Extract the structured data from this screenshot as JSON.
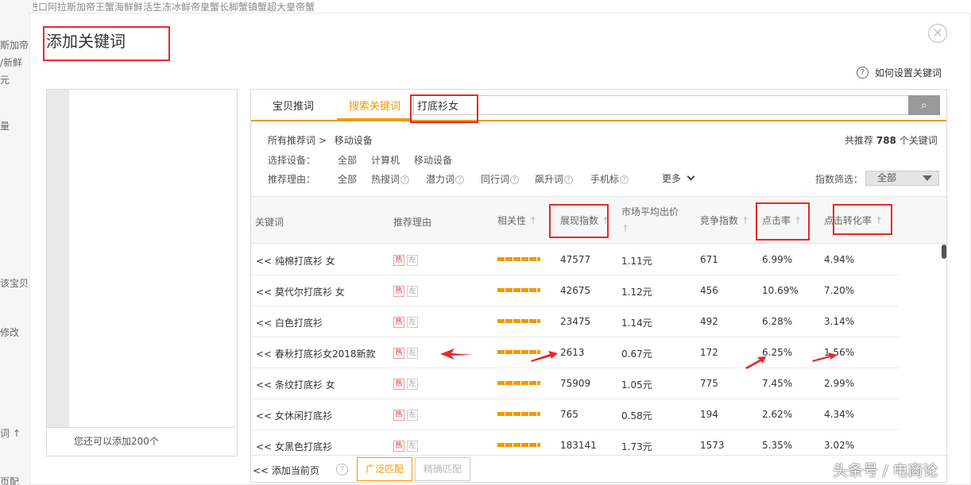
{
  "background": {
    "top_text": "宝贝：进口阿拉斯加帝王蟹海鲜鲜活生冻冰鲜帝皇蟹长脚蟹镇蟹超大皇帝蟹",
    "left_fragments": [
      "斯加帝",
      "/新鲜",
      "元",
      "量",
      "",
      "该宝贝",
      "修改",
      "",
      "词 ↑",
      "页配"
    ]
  },
  "dialog": {
    "title": "添加关键词",
    "close_glyph": "×",
    "help_text": "如何设置关键词",
    "help_glyph": "?"
  },
  "left_panel": {
    "footer": "您还可以添加200个"
  },
  "tabs": [
    {
      "label": "宝贝推词"
    },
    {
      "label": "搜索关键词"
    }
  ],
  "search": {
    "value": "打底衫女",
    "button_glyph": "⌕"
  },
  "breadcrumb": {
    "root": "所有推荐词",
    "separator": ">",
    "current": "移动设备"
  },
  "total": {
    "prefix": "共推荐",
    "count": "788",
    "suffix": "个关键词"
  },
  "device_filter": {
    "label": "选择设备：",
    "options": [
      "全部",
      "计算机",
      "移动设备"
    ]
  },
  "reason_filter": {
    "label": "推荐理由：",
    "options": [
      "全部",
      "热搜词",
      "潜力词",
      "同行词",
      "飙升词",
      "手机标"
    ],
    "more": "更多"
  },
  "index_filter": {
    "label": "指数筛选：",
    "value": "全部"
  },
  "table": {
    "headers": {
      "keyword": "关键词",
      "reason": "推荐理由",
      "relevance": "相关性",
      "impressions": "展现指数",
      "avg_bid": "市场平均出价",
      "competition": "竞争指数",
      "ctr": "点击率",
      "cvr": "点击转化率"
    },
    "sort_glyph": "↑",
    "add_glyph": "<<",
    "tag_hot": "热",
    "tag_left": "左",
    "rows": [
      {
        "keyword": "纯棉打底衫 女",
        "impressions": "47577",
        "avg_bid": "1.11元",
        "competition": "671",
        "ctr": "6.99%",
        "cvr": "4.94%"
      },
      {
        "keyword": "莫代尔打底衫 女",
        "impressions": "42675",
        "avg_bid": "1.12元",
        "competition": "456",
        "ctr": "10.69%",
        "cvr": "7.20%"
      },
      {
        "keyword": "白色打底衫",
        "impressions": "23475",
        "avg_bid": "1.14元",
        "competition": "492",
        "ctr": "6.28%",
        "cvr": "3.14%"
      },
      {
        "keyword": "春秋打底衫女2018新款",
        "impressions": "2613",
        "avg_bid": "0.67元",
        "competition": "172",
        "ctr": "6.25%",
        "cvr": "1.56%"
      },
      {
        "keyword": "条纹打底衫 女",
        "impressions": "75909",
        "avg_bid": "1.05元",
        "competition": "775",
        "ctr": "7.45%",
        "cvr": "2.99%"
      },
      {
        "keyword": "女休闲打底衫",
        "impressions": "765",
        "avg_bid": "0.58元",
        "competition": "194",
        "ctr": "2.62%",
        "cvr": "4.34%"
      },
      {
        "keyword": "女黑色打底衫",
        "impressions": "183141",
        "avg_bid": "1.73元",
        "competition": "1573",
        "ctr": "5.35%",
        "cvr": "3.02%"
      }
    ]
  },
  "bottom": {
    "add_page": "<< 添加当前页",
    "broad_match": "广泛匹配",
    "exact_match": "精确匹配"
  },
  "watermark": "头条号 / 电商论",
  "colors": {
    "accent": "#f39800",
    "annotation": "#e8282b",
    "disabled": "#bbbbbb"
  }
}
